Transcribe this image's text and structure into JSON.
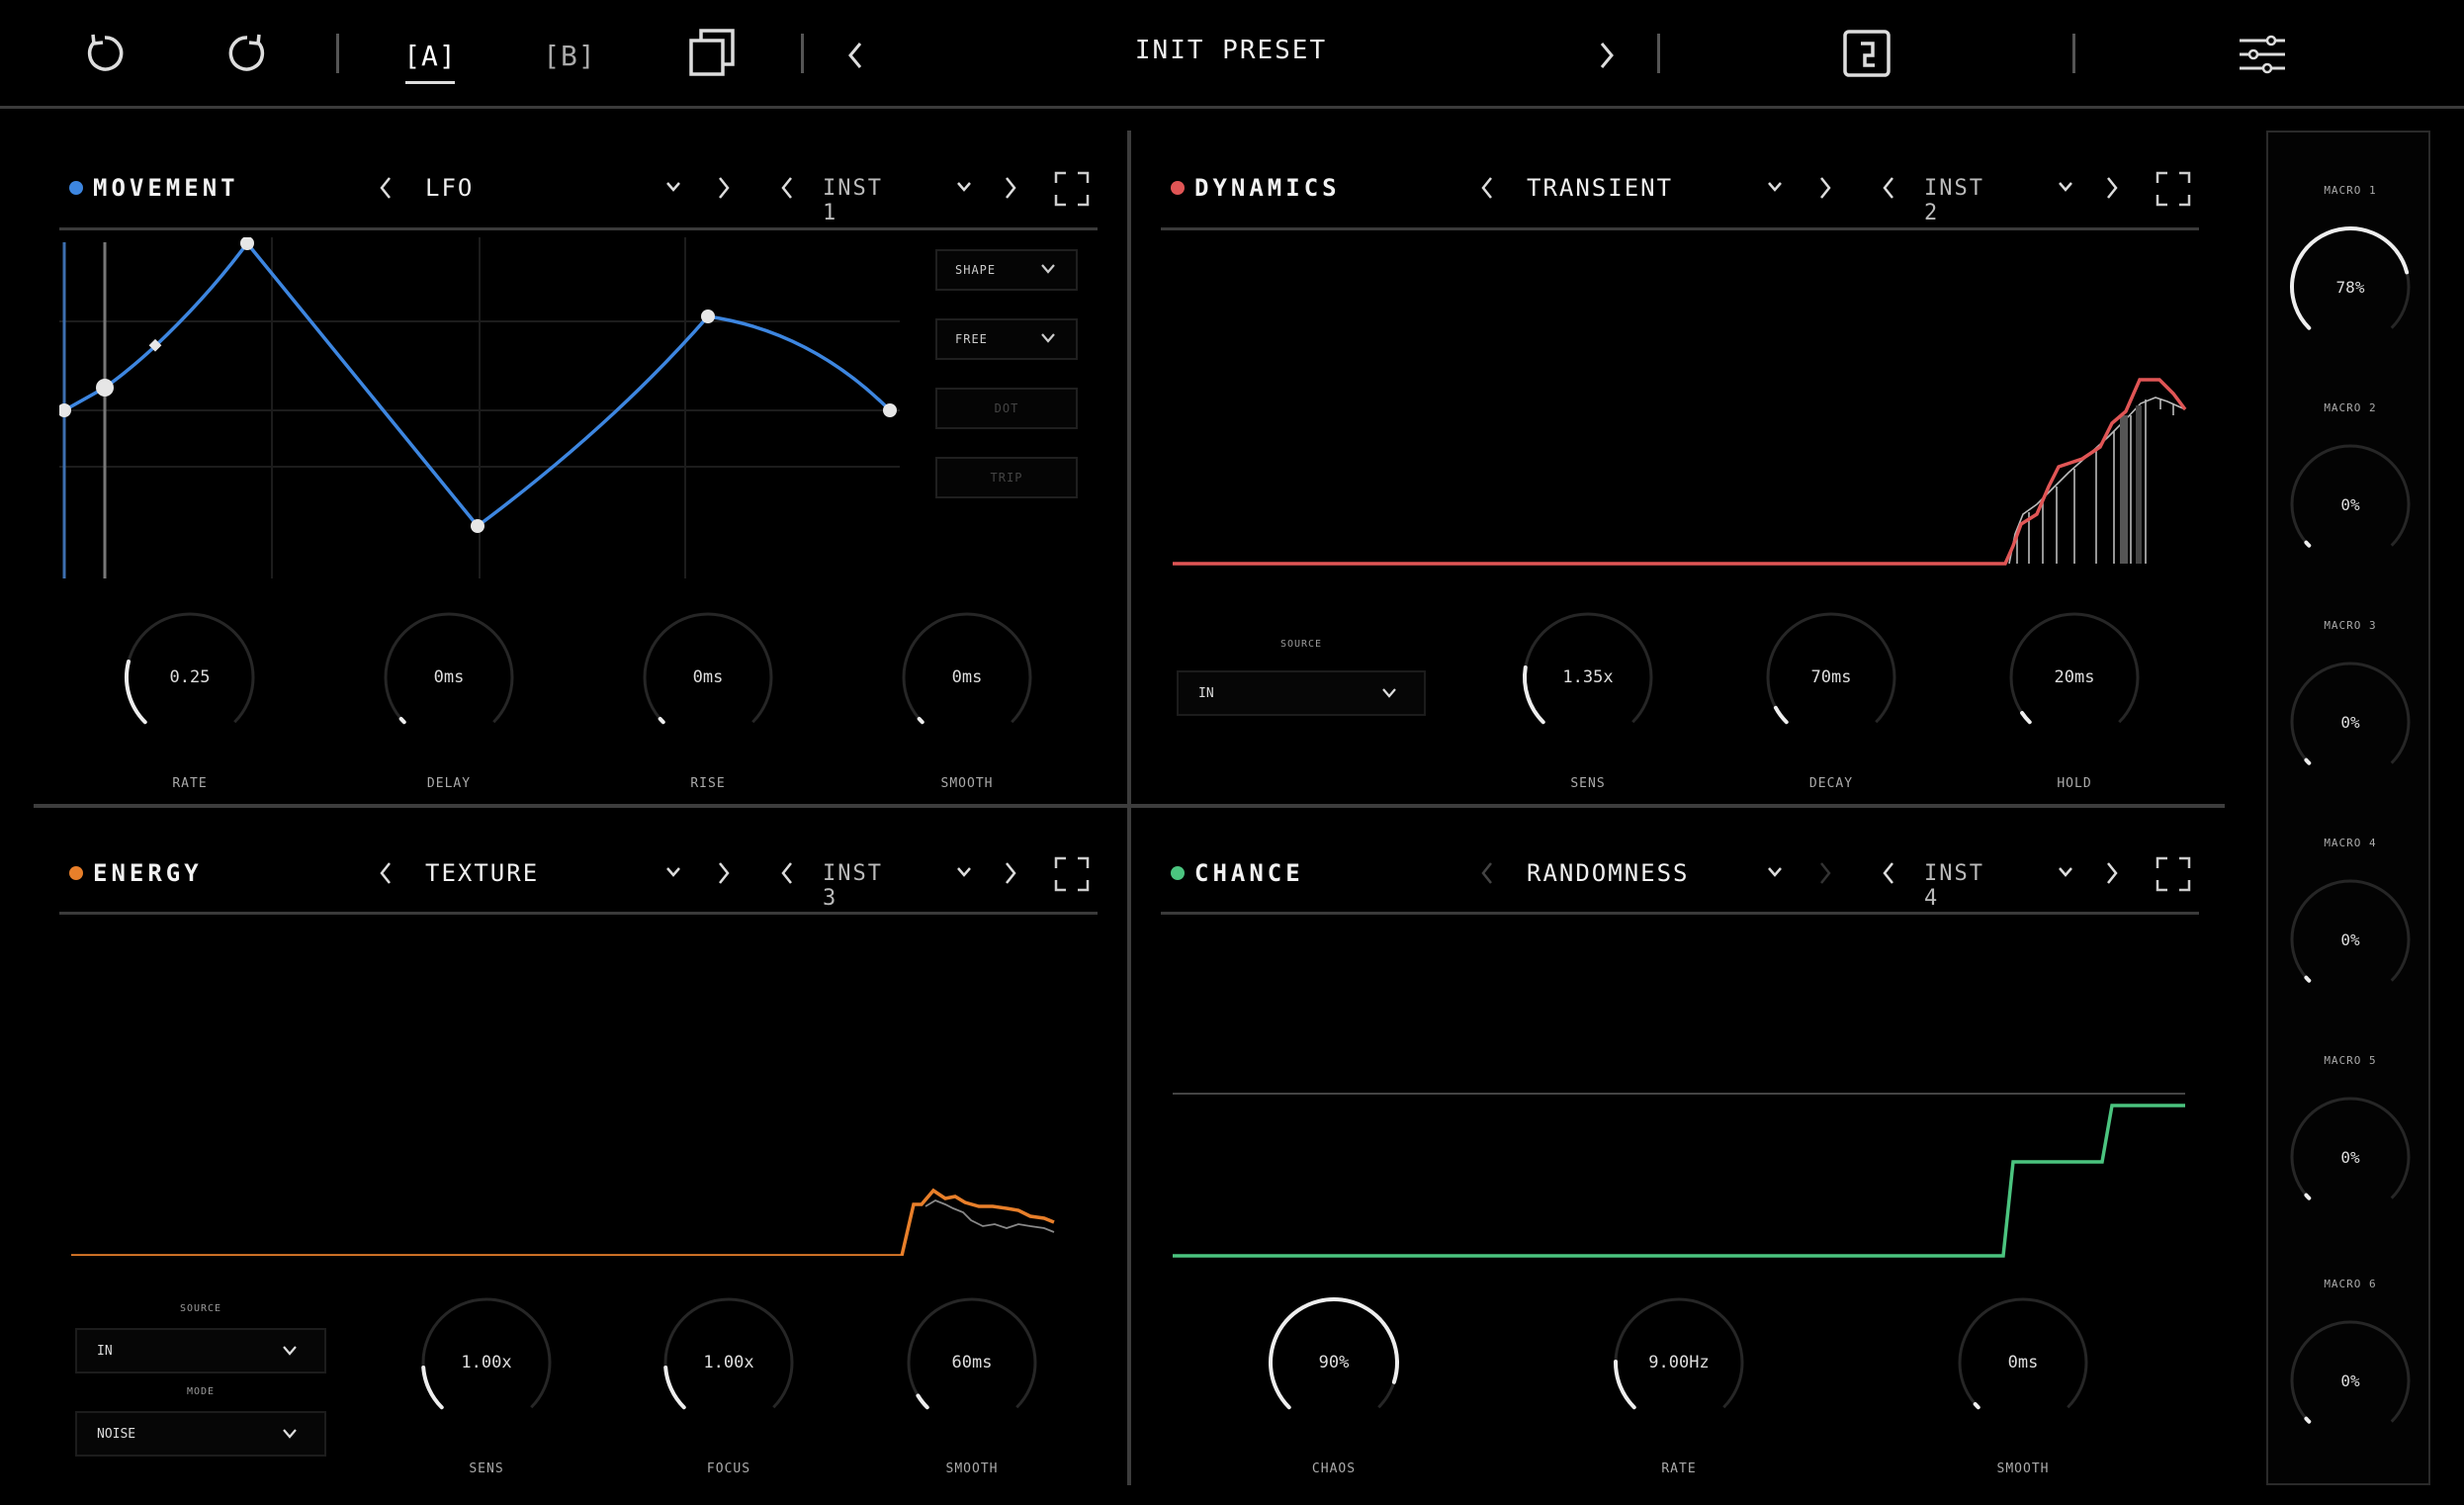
{
  "topbar": {
    "slot_a": "[A]",
    "slot_b": "[B]",
    "preset_name": "INIT PRESET"
  },
  "panels": [
    {
      "title": "MOVEMENT",
      "color": "#3d86e0",
      "mode": "LFO",
      "inst": "INST 1",
      "buttons": [
        "SHAPE",
        "FREE",
        "DOT",
        "TRIP"
      ],
      "knobs": [
        {
          "label": "RATE",
          "value": "0.25",
          "level": 0.22
        },
        {
          "label": "DELAY",
          "value": "0ms",
          "level": 0
        },
        {
          "label": "RISE",
          "value": "0ms",
          "level": 0
        },
        {
          "label": "SMOOTH",
          "value": "0ms",
          "level": 0
        }
      ]
    },
    {
      "title": "DYNAMICS",
      "color": "#e05555",
      "mode": "TRANSIENT",
      "inst": "INST 2",
      "source_label": "SOURCE",
      "source_value": "IN",
      "knobs": [
        {
          "label": "SENS",
          "value": "1.35x",
          "level": 0.2
        },
        {
          "label": "DECAY",
          "value": "70ms",
          "level": 0.06
        },
        {
          "label": "HOLD",
          "value": "20ms",
          "level": 0.04
        }
      ]
    },
    {
      "title": "ENERGY",
      "color": "#e87f2a",
      "mode": "TEXTURE",
      "inst": "INST 3",
      "source_label": "SOURCE",
      "source_value": "IN",
      "mode_label": "MODE",
      "mode_value": "NOISE",
      "knobs": [
        {
          "label": "SENS",
          "value": "1.00x",
          "level": 0.15
        },
        {
          "label": "FOCUS",
          "value": "1.00x",
          "level": 0.15
        },
        {
          "label": "SMOOTH",
          "value": "60ms",
          "level": 0.05
        }
      ]
    },
    {
      "title": "CHANCE",
      "color": "#4bc47f",
      "mode": "RANDOMNESS",
      "inst": "INST 4",
      "knobs": [
        {
          "label": "CHAOS",
          "value": "90%",
          "level": 0.9
        },
        {
          "label": "RATE",
          "value": "9.00Hz",
          "level": 0.17
        },
        {
          "label": "SMOOTH",
          "value": "0ms",
          "level": 0
        }
      ]
    }
  ],
  "macros": [
    {
      "label": "MACRO 1",
      "value": "78%",
      "level": 0.78
    },
    {
      "label": "MACRO 2",
      "value": "0%",
      "level": 0
    },
    {
      "label": "MACRO 3",
      "value": "0%",
      "level": 0
    },
    {
      "label": "MACRO 4",
      "value": "0%",
      "level": 0
    },
    {
      "label": "MACRO 5",
      "value": "0%",
      "level": 0
    },
    {
      "label": "MACRO 6",
      "value": "0%",
      "level": 0
    }
  ]
}
